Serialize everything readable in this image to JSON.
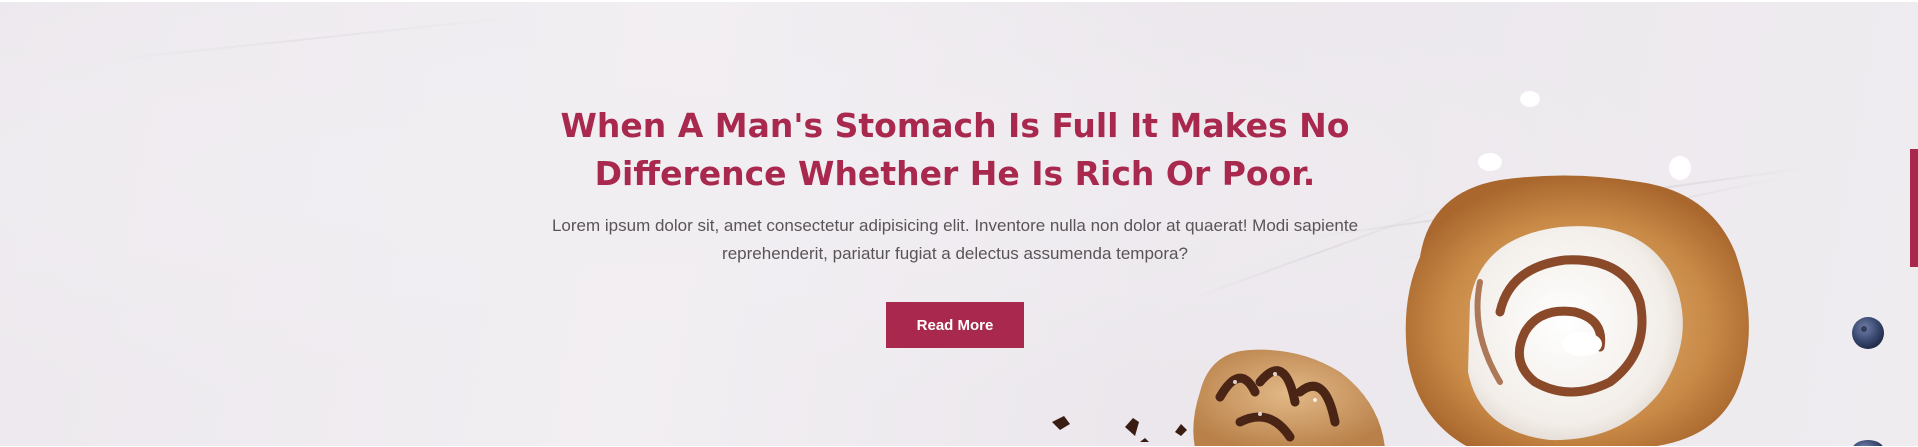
{
  "hero": {
    "title": "When A Man's Stomach Is Full It Makes No Difference Whether He Is Rich Or Poor.",
    "text": "Lorem ipsum dolor sit, amet consectetur adipisicing elit. Inventore nulla non dolor at quaerat! Modi sapiente reprehenderit, pariatur fugiat a delectus assumenda tempora?",
    "button_label": "Read More"
  },
  "colors": {
    "accent": "#a8294d",
    "text": "#5a5458",
    "background": "#eeebef"
  },
  "icons": {
    "pastry": "cinnamon-roll-image",
    "danish": "chocolate-danish-image",
    "berry": "blueberry-image"
  }
}
